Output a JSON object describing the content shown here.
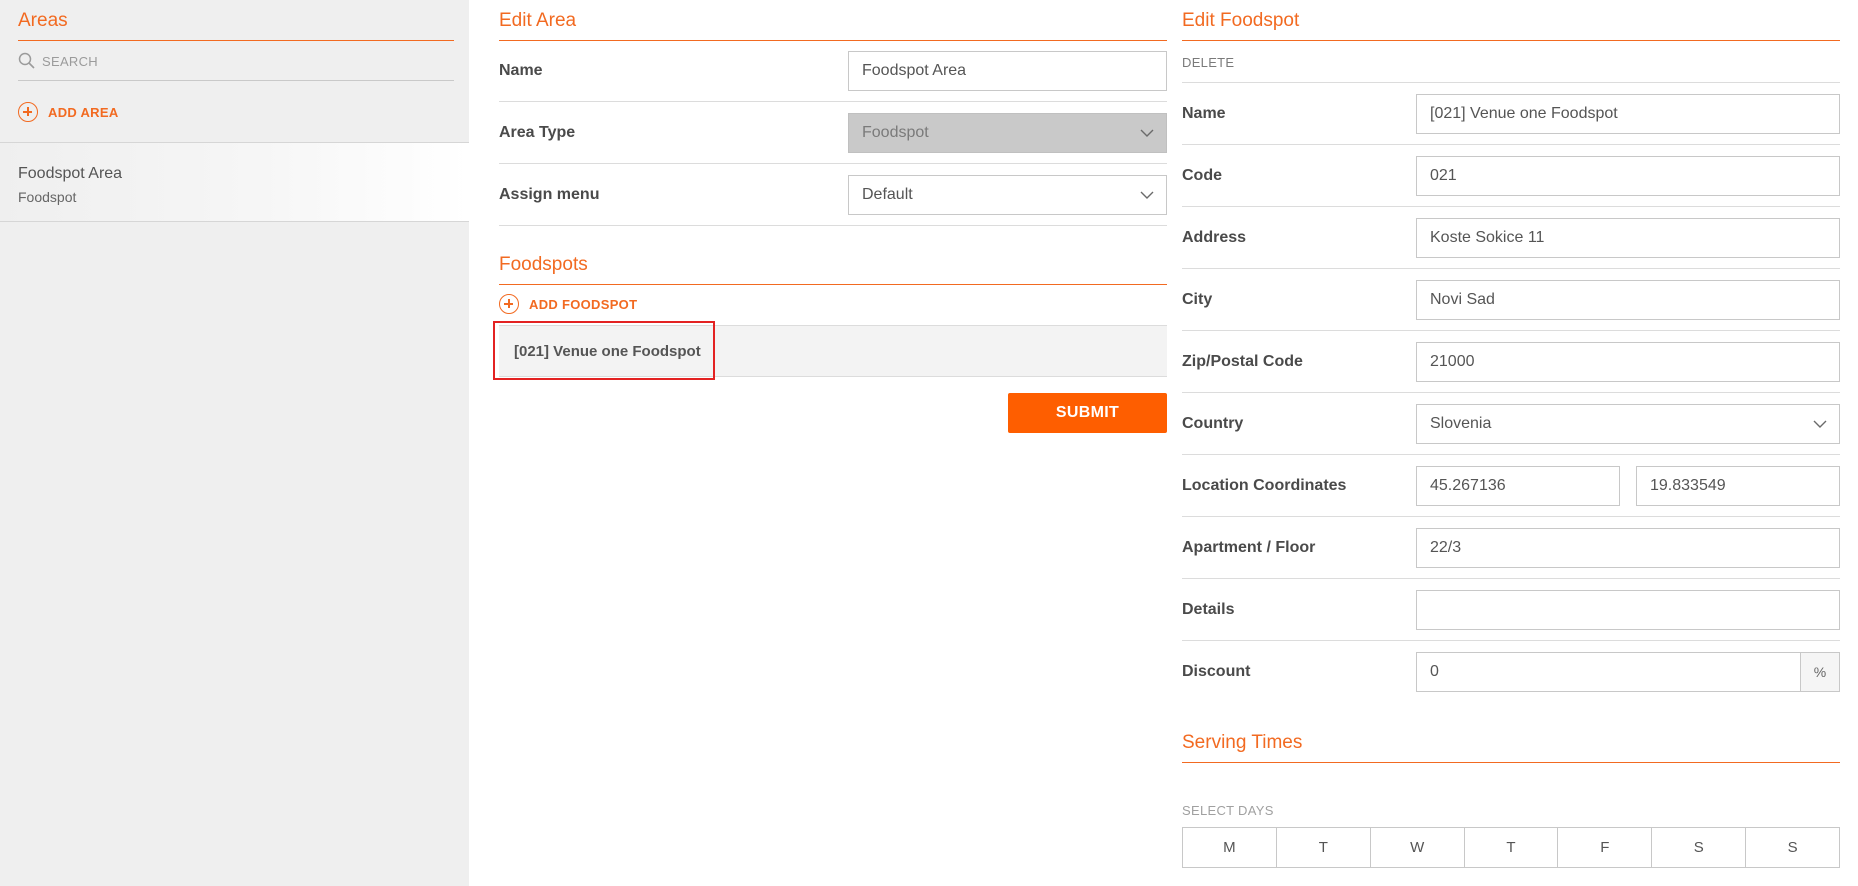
{
  "sidebar": {
    "title": "Areas",
    "search_placeholder": "SEARCH",
    "add_area_label": "ADD AREA",
    "items": [
      {
        "name": "Foodspot Area",
        "type": "Foodspot"
      }
    ]
  },
  "edit_area": {
    "title": "Edit Area",
    "name_label": "Name",
    "name_value": "Foodspot Area",
    "area_type_label": "Area Type",
    "area_type_value": "Foodspot",
    "assign_menu_label": "Assign menu",
    "assign_menu_value": "Default",
    "foodspots_title": "Foodspots",
    "add_foodspot_label": "ADD FOODSPOT",
    "foodspots": [
      {
        "label": "[021] Venue one Foodspot"
      }
    ],
    "submit_label": "SUBMIT"
  },
  "edit_foodspot": {
    "title": "Edit Foodspot",
    "delete_label": "DELETE",
    "fields": {
      "name": {
        "label": "Name",
        "value": "[021] Venue one Foodspot"
      },
      "code": {
        "label": "Code",
        "value": "021"
      },
      "address": {
        "label": "Address",
        "value": "Koste Sokice 11"
      },
      "city": {
        "label": "City",
        "value": "Novi Sad"
      },
      "zip": {
        "label": "Zip/Postal Code",
        "value": "21000"
      },
      "country": {
        "label": "Country",
        "value": "Slovenia"
      },
      "location": {
        "label": "Location Coordinates",
        "lat": "45.267136",
        "lng": "19.833549"
      },
      "apartment": {
        "label": "Apartment / Floor",
        "value": "22/3"
      },
      "details": {
        "label": "Details",
        "value": ""
      },
      "discount": {
        "label": "Discount",
        "value": "0",
        "unit": "%"
      }
    },
    "serving_times_title": "Serving Times",
    "select_days_label": "SELECT DAYS",
    "days": [
      "M",
      "T",
      "W",
      "T",
      "F",
      "S",
      "S"
    ]
  },
  "colors": {
    "accent": "#f26a21",
    "submit": "#fe5e00",
    "highlight": "#e32222",
    "sidebar_bg": "#efefef"
  }
}
